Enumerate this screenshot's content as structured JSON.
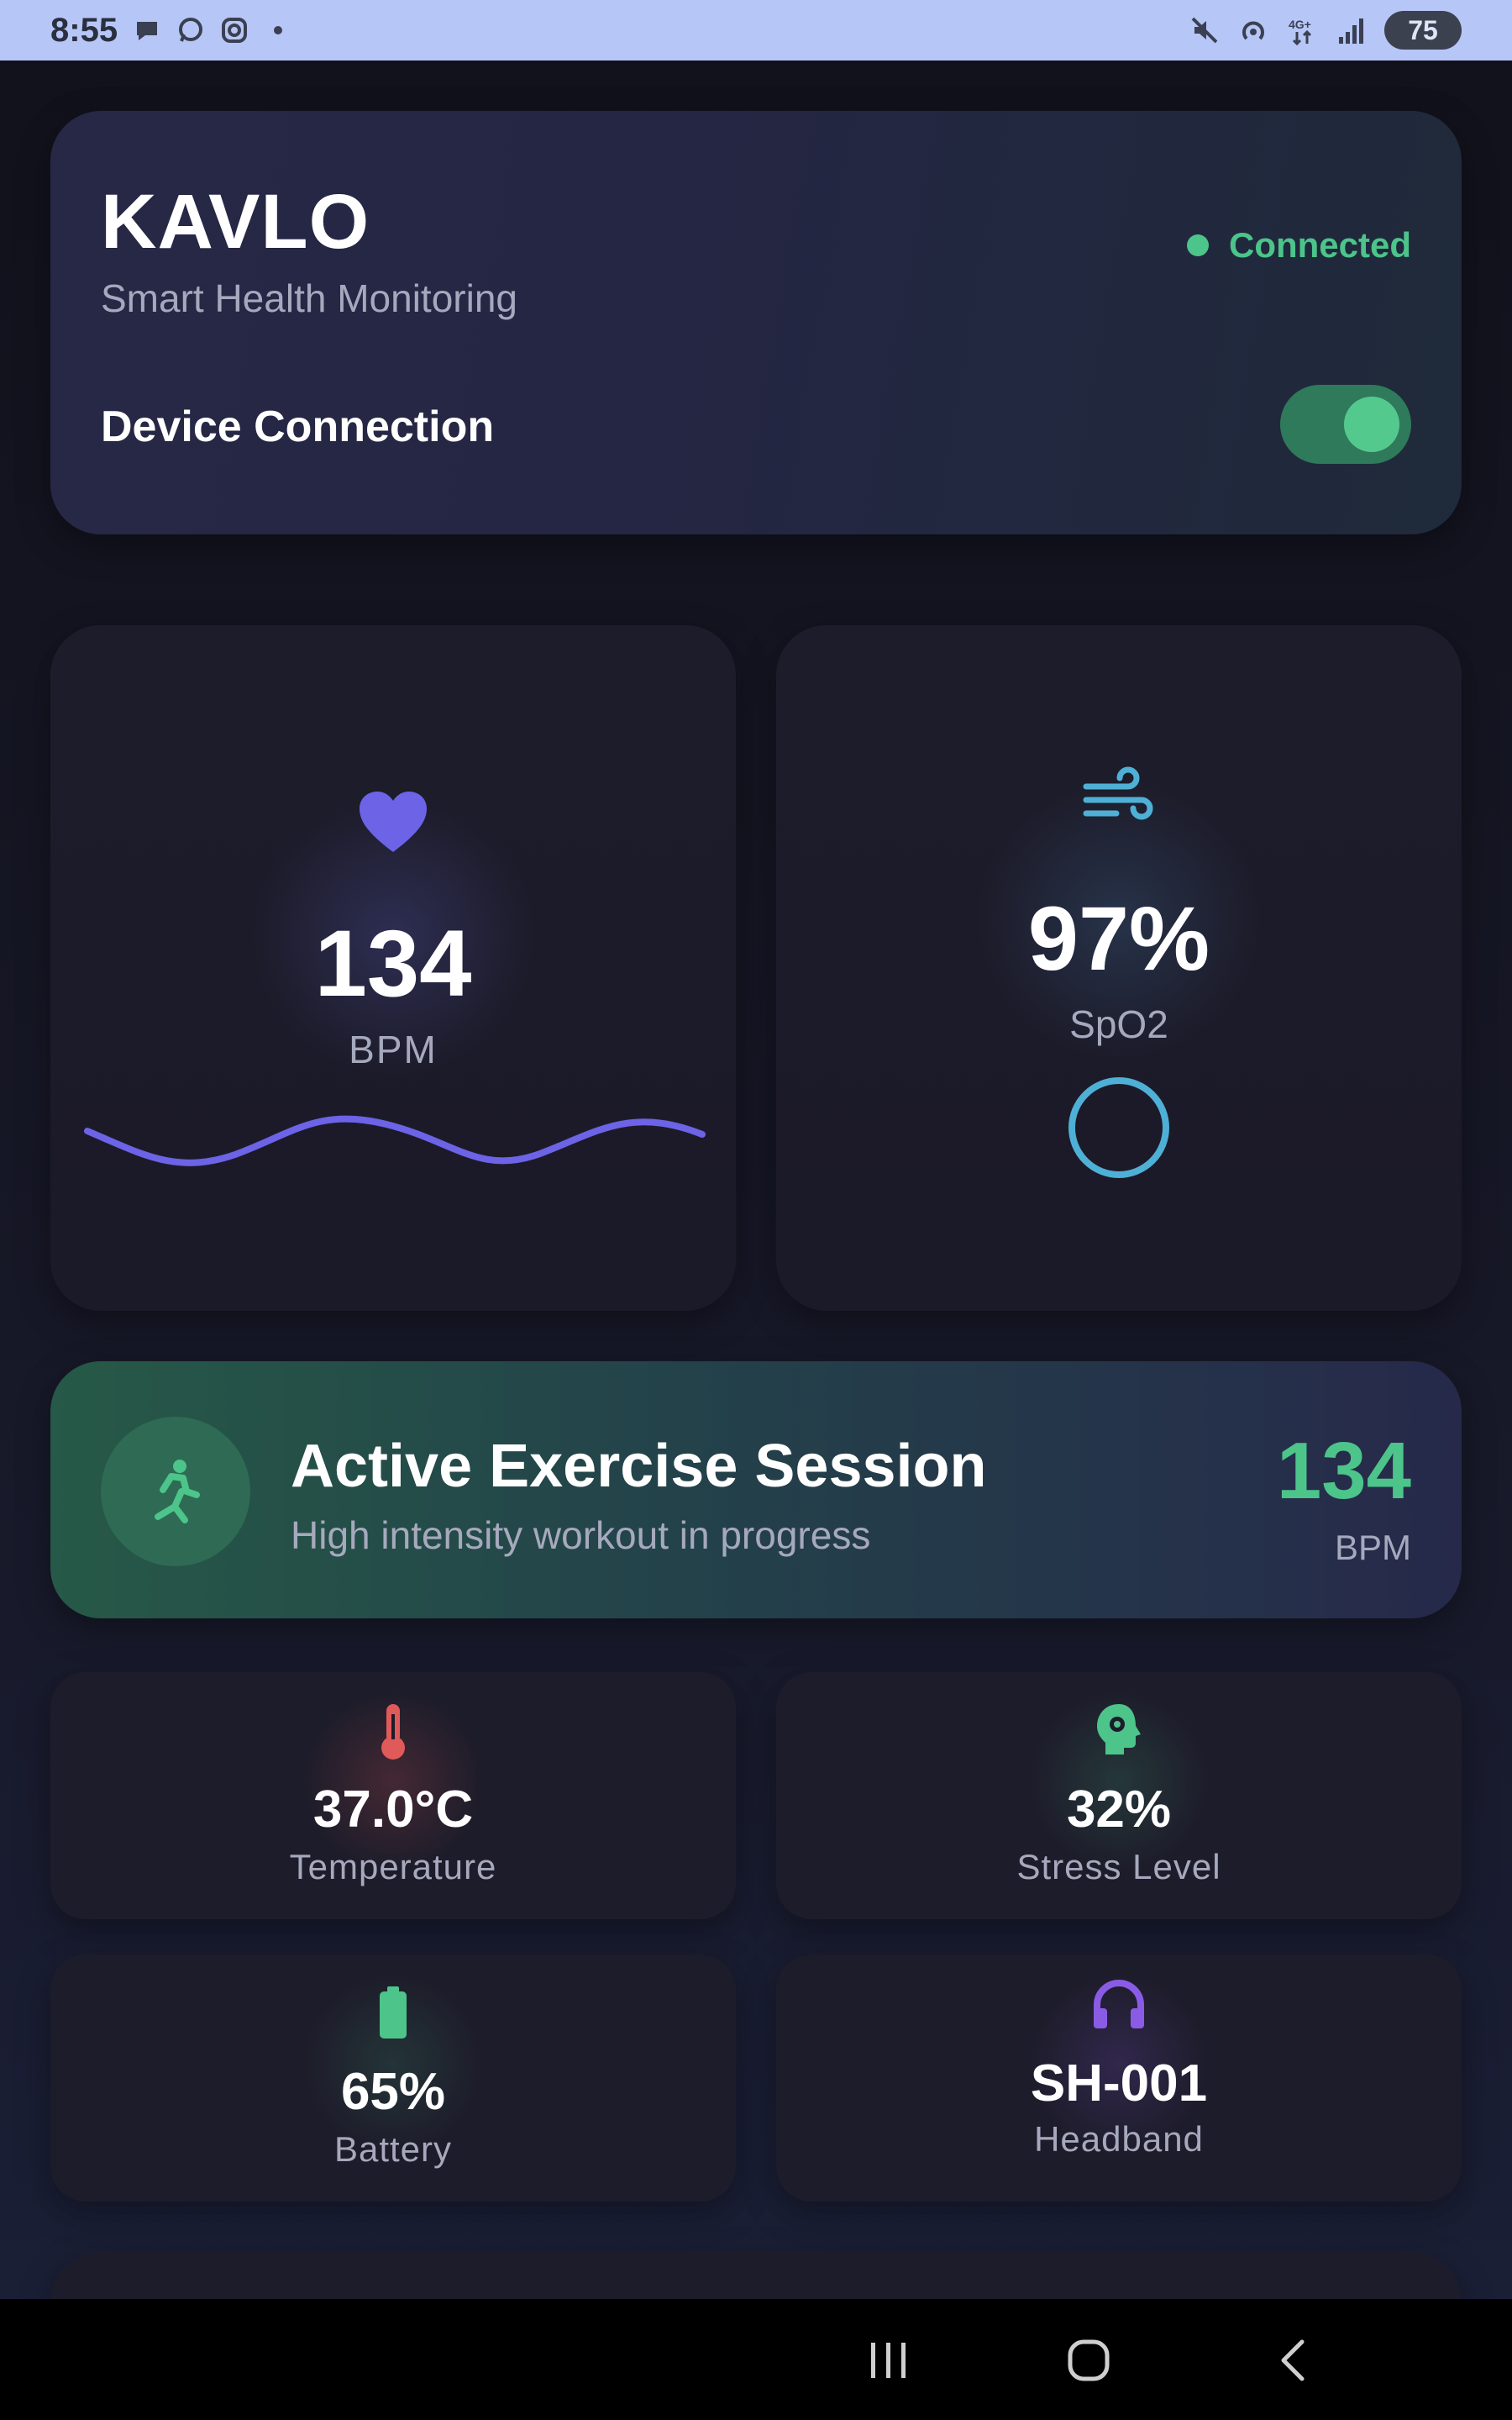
{
  "status_bar": {
    "time": "8:55",
    "battery": "75",
    "left_icons": [
      "chat-bubble-icon",
      "whatsapp-icon",
      "instagram-icon",
      "dot-icon"
    ],
    "right_icons": [
      "mute-icon",
      "hotspot-icon",
      "4g-data-icon",
      "signal-icon"
    ]
  },
  "header": {
    "title": "KAVLO",
    "subtitle": "Smart Health Monitoring",
    "connection_status": "Connected",
    "device_connection_label": "Device Connection",
    "device_connection_on": true
  },
  "heart_rate": {
    "value": "134",
    "unit": "BPM",
    "icon": "heart-icon",
    "color": "#6c63e6"
  },
  "spo2": {
    "value": "97%",
    "label": "SpO2",
    "icon": "wind-icon",
    "color": "#4fb0d6"
  },
  "exercise": {
    "title": "Active Exercise Session",
    "subtitle": "High intensity workout in progress",
    "value": "134",
    "unit": "BPM",
    "icon": "running-icon",
    "color": "#4cc48a"
  },
  "stats": [
    {
      "value": "37.0°C",
      "label": "Temperature",
      "icon": "thermometer-icon",
      "color": "#e05a5a"
    },
    {
      "value": "32%",
      "label": "Stress Level",
      "icon": "brain-gear-icon",
      "color": "#4cc48a"
    },
    {
      "value": "65%",
      "label": "Battery",
      "icon": "battery-icon",
      "color": "#4cc48a"
    },
    {
      "value": "SH-001",
      "label": "Headband",
      "icon": "headphones-icon",
      "color": "#8a5ce6"
    }
  ],
  "nav": [
    "recent-apps-icon",
    "home-icon",
    "back-icon"
  ]
}
